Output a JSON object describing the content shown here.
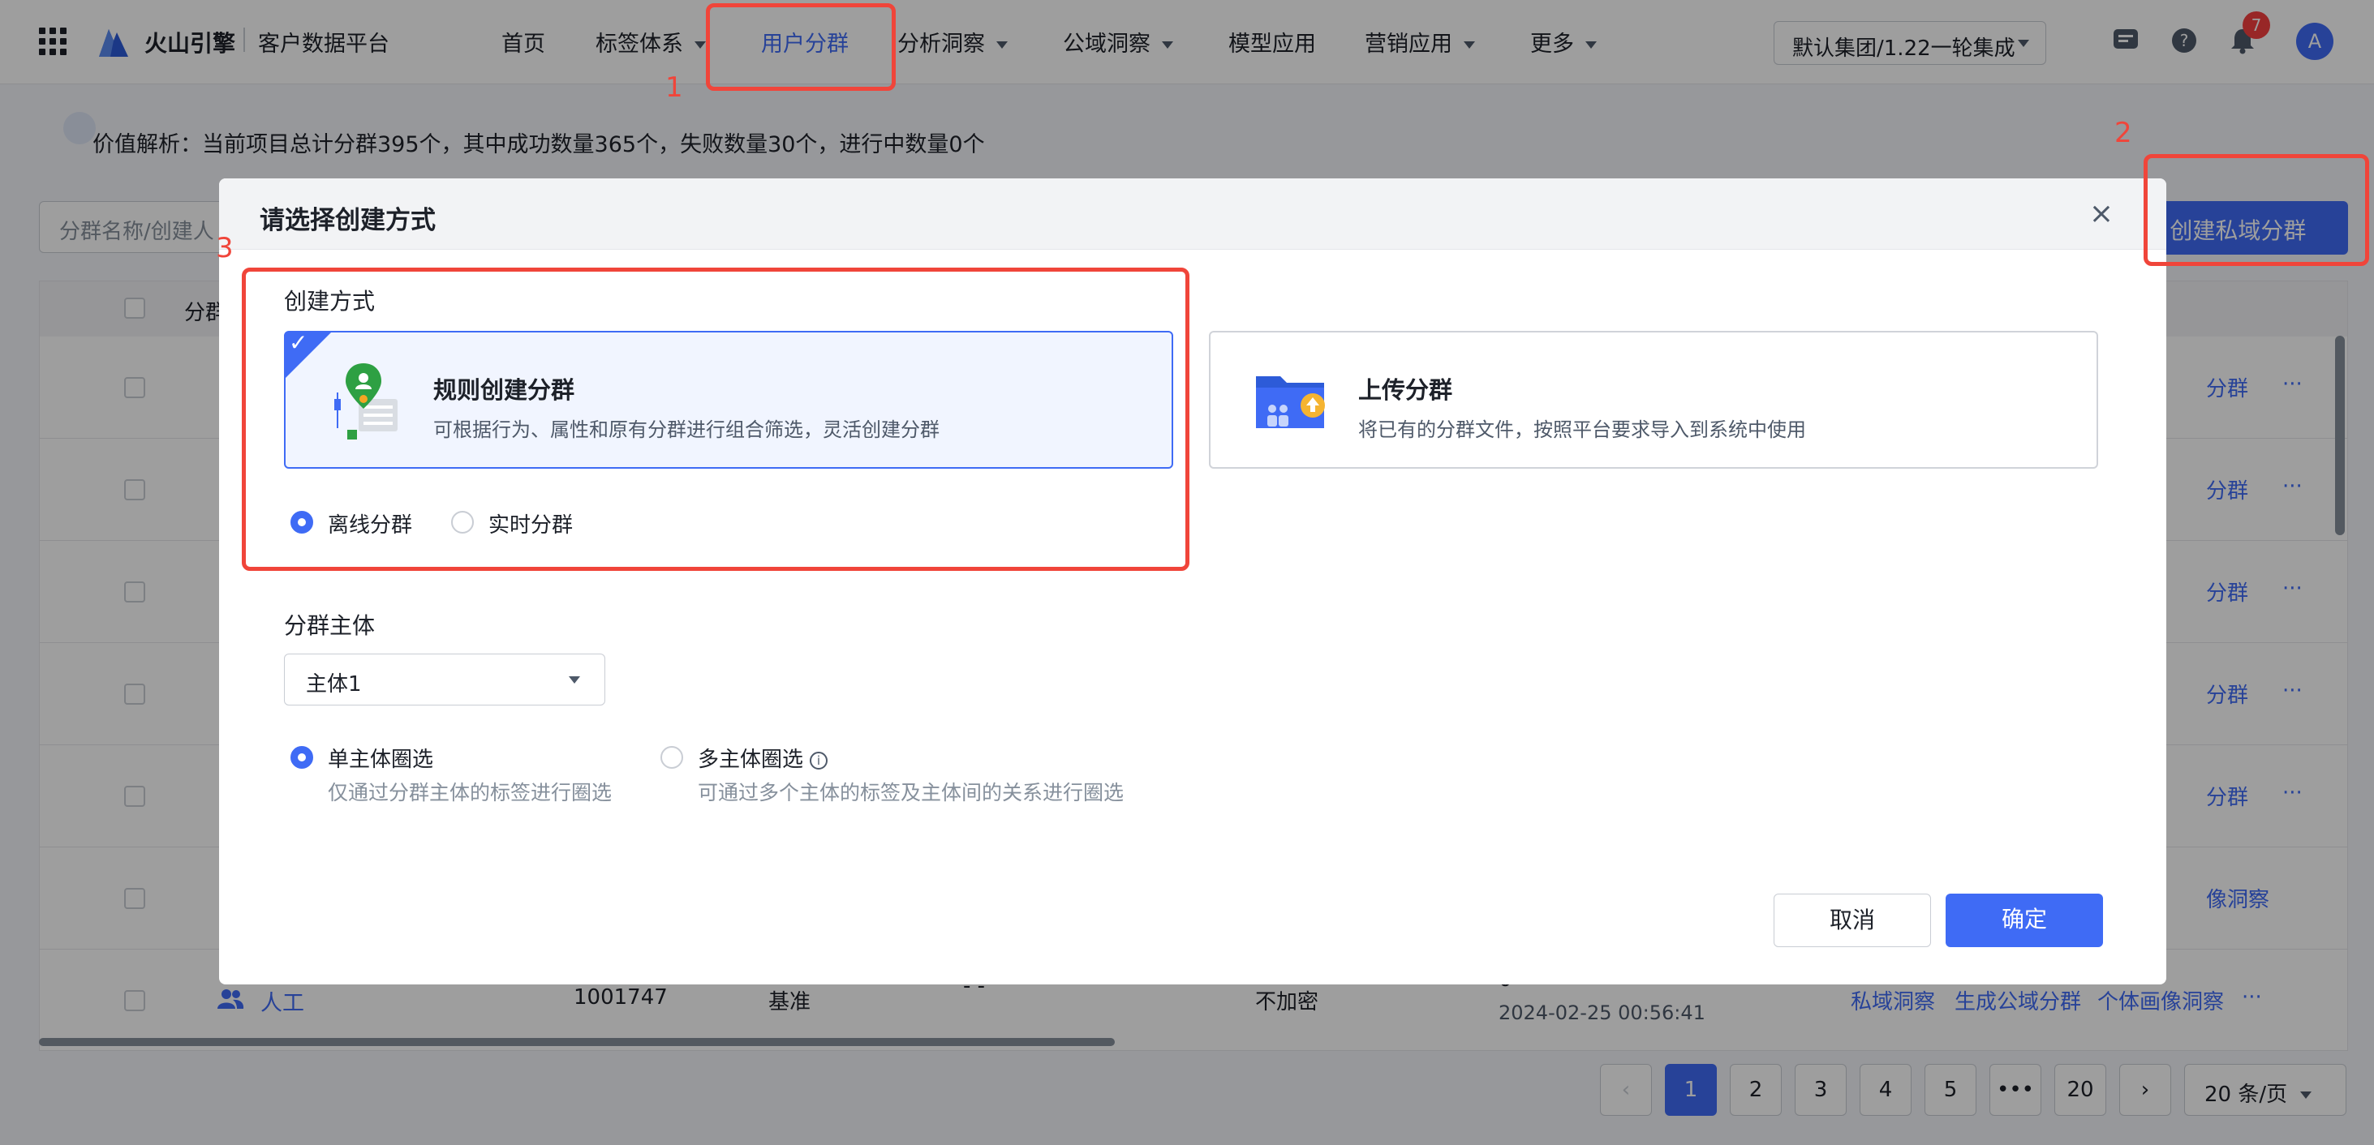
{
  "topbar": {
    "brand": "火山引擎",
    "product": "客户数据平台",
    "nav": [
      "首页",
      "标签体系",
      "用户分群",
      "分析洞察",
      "公域洞察",
      "模型应用",
      "营销应用",
      "更多"
    ],
    "project": "默认集团/1.22一轮集成",
    "notification_count": "7",
    "avatar_letter": "A"
  },
  "page": {
    "tip": "价值解析：当前项目总计分群395个，其中成功数量365个，失败数量30个，进行中数量0个",
    "search_placeholder": "分群名称/创建人",
    "create_button": "+ 创建私域分群",
    "table_header_first": "分群",
    "last_row": {
      "name": "人工",
      "id": "1001747",
      "type": "基准",
      "dash": "- -",
      "encrypt": "不加密",
      "count": "0",
      "time": "2024-02-25 00:56:41",
      "actions": [
        "私域洞察",
        "生成公域分群",
        "个体画像洞察",
        "···"
      ]
    },
    "row_actions": [
      "分群",
      "分群",
      "分群",
      "分群",
      "分群",
      "像洞察"
    ],
    "more": "···",
    "pagination": [
      "1",
      "2",
      "3",
      "4",
      "5",
      "•••",
      "20"
    ],
    "prev": "‹",
    "next": "›",
    "page_size": "20 条/页"
  },
  "modal": {
    "title": "请选择创建方式",
    "close": "×",
    "method_label": "创建方式",
    "options": [
      {
        "title": "规则创建分群",
        "desc": "可根据行为、属性和原有分群进行组合筛选，灵活创建分群"
      },
      {
        "title": "上传分群",
        "desc": "将已有的分群文件，按照平台要求导入到系统中使用"
      }
    ],
    "check": "✓",
    "timing": [
      "离线分群",
      "实时分群"
    ],
    "subject_label": "分群主体",
    "subject_value": "主体1",
    "scope": [
      {
        "label": "单主体圈选",
        "desc": "仅通过分群主体的标签进行圈选"
      },
      {
        "label": "多主体圈选",
        "desc": "可通过多个主体的标签及主体间的关系进行圈选"
      }
    ],
    "info": "i",
    "cancel": "取消",
    "confirm": "确定"
  },
  "annotations": [
    "1",
    "2",
    "3"
  ],
  "colors": {
    "accent": "#3f6bf5",
    "annotation": "#f0453a"
  }
}
